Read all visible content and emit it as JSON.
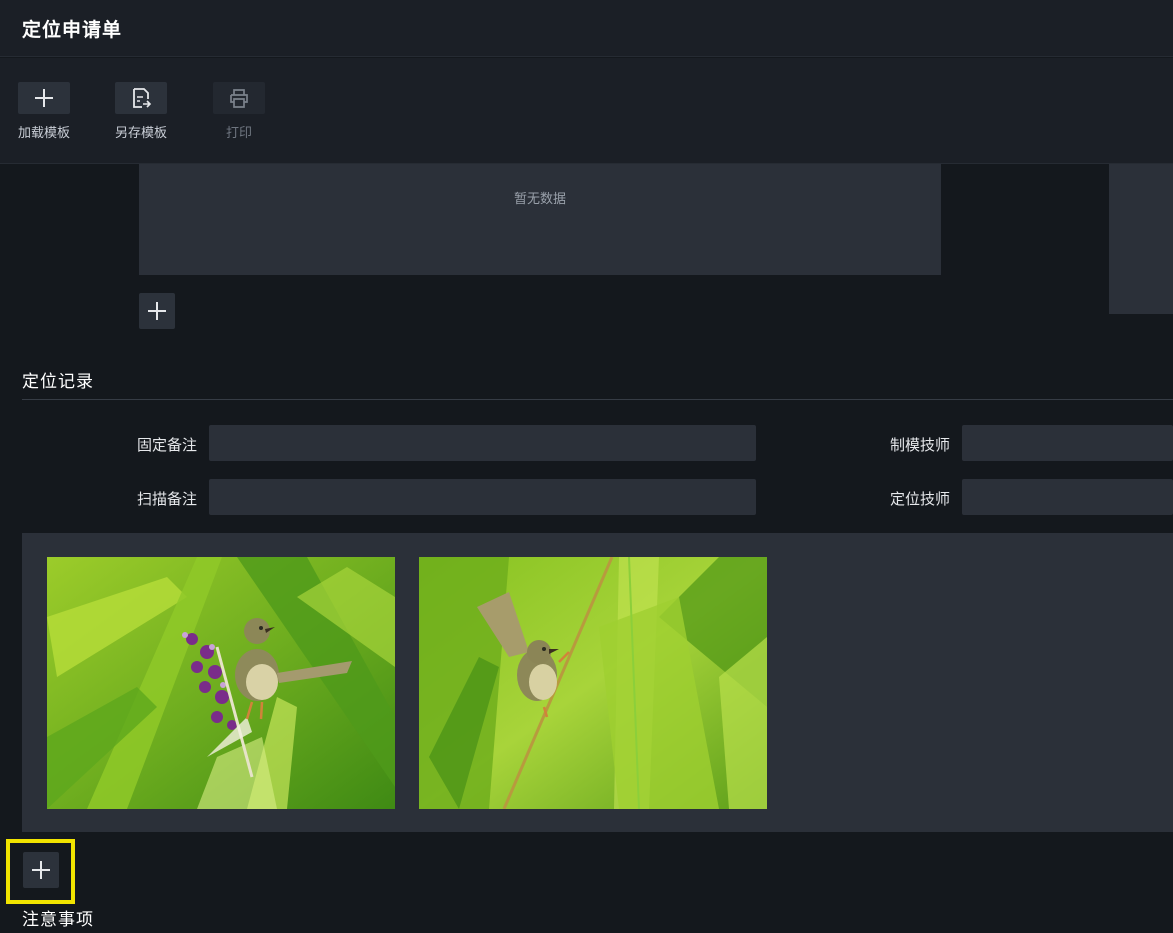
{
  "header": {
    "title": "定位申请单"
  },
  "toolbar": {
    "load_template": "加载模板",
    "save_template": "另存模板",
    "print": "打印"
  },
  "top_panel": {
    "empty_text": "暂无数据"
  },
  "positioning_record": {
    "title": "定位记录",
    "fixed_note_label": "固定备注",
    "fixed_note_value": "",
    "scan_note_label": "扫描备注",
    "scan_note_value": "",
    "mold_tech_label": "制模技师",
    "mold_tech_value": "",
    "position_tech_label": "定位技师",
    "position_tech_value": ""
  },
  "notes": {
    "title": "注意事项"
  },
  "icons": {
    "load_template": "plus-icon",
    "save_template": "save-as-icon",
    "print": "printer-icon",
    "add": "plus-icon"
  },
  "colors": {
    "background": "#14181d",
    "panel": "#2b3039",
    "button": "#2c323b",
    "highlight": "#f2e400"
  }
}
